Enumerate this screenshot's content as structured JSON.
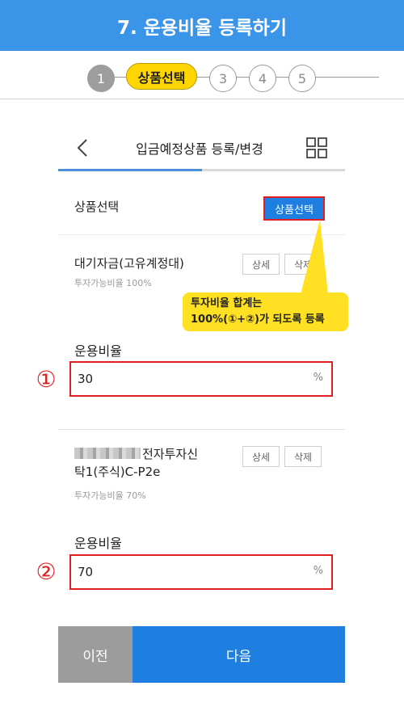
{
  "header": {
    "title": "7. 운용비율 등록하기"
  },
  "steps": {
    "items": [
      {
        "label": "1",
        "state": "done"
      },
      {
        "label": "상품선택",
        "state": "active"
      },
      {
        "label": "3",
        "state": "todo"
      },
      {
        "label": "4",
        "state": "todo"
      },
      {
        "label": "5",
        "state": "todo"
      }
    ]
  },
  "nav": {
    "title": "입금예정상품 등록/변경"
  },
  "product_select": {
    "label": "상품선택",
    "button": "상품선택"
  },
  "products": [
    {
      "name": "대기자금(고유계정대)",
      "ratio": "투자가능비율 100%",
      "detail_button": "상세",
      "delete_button": "삭제",
      "ratio_field": {
        "label": "운용비율",
        "value": "30",
        "unit": "%"
      }
    },
    {
      "name_line1": "전자투자신",
      "name_line2": "탁1(주식)C-P2e",
      "ratio": "투자가능비율 70%",
      "detail_button": "상세",
      "delete_button": "삭제",
      "ratio_field": {
        "label": "운용비율",
        "value": "70",
        "unit": "%"
      }
    }
  ],
  "annotations": {
    "tooltip_line1": "투자비율 합계는",
    "tooltip_line2": "100%(①+②)가 되도록 등록",
    "marker1": "①",
    "marker2": "②"
  },
  "footer": {
    "prev": "이전",
    "next": "다음"
  },
  "colors": {
    "primary": "#1f7fe0",
    "header": "#3a95e8",
    "highlight": "#ffd500",
    "callout": "#e02020"
  }
}
